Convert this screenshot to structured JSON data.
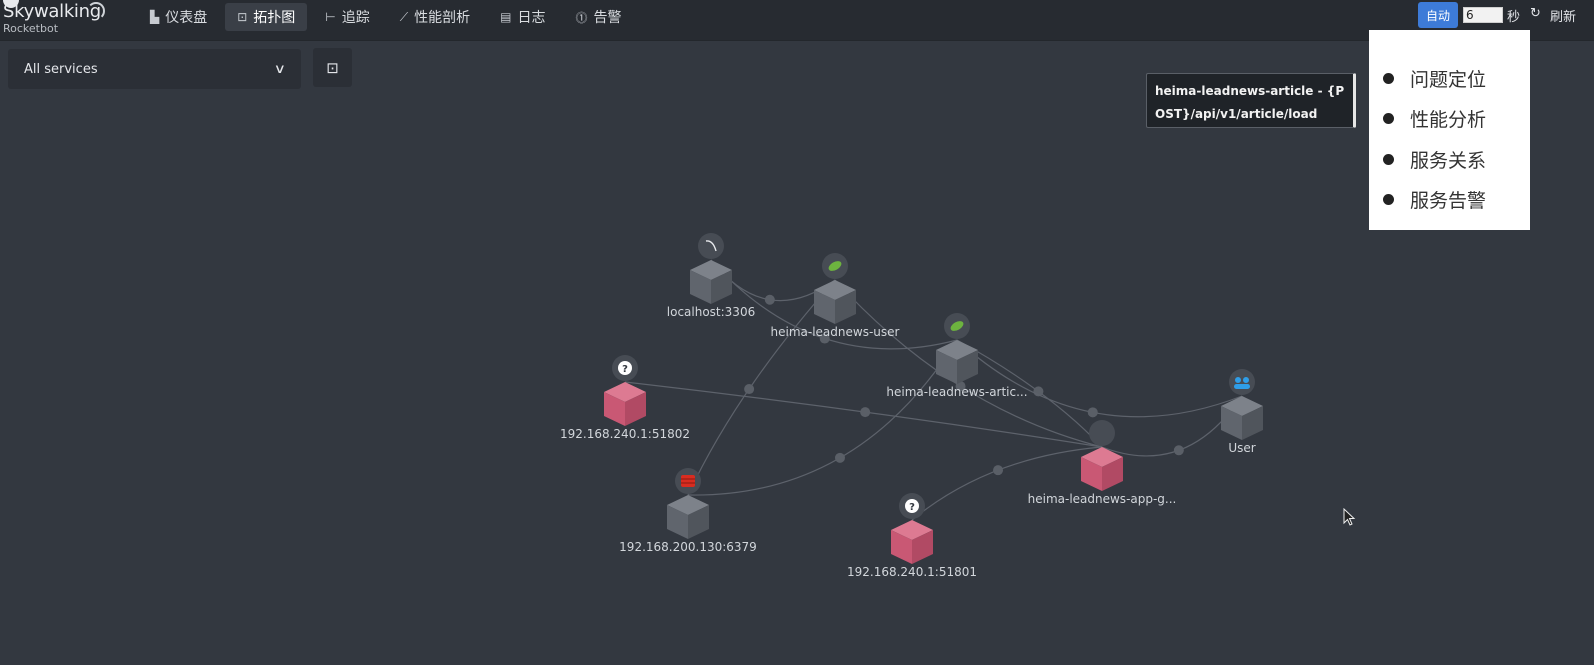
{
  "brand": {
    "name": "Skywalking",
    "sub": "Rocketbot"
  },
  "nav": [
    {
      "label": "仪表盘",
      "icon": "bar-chart-icon",
      "glyph": "▙"
    },
    {
      "label": "拓扑图",
      "icon": "topology-icon",
      "glyph": "⊡",
      "active": true
    },
    {
      "label": "追踪",
      "icon": "trace-icon",
      "glyph": "⊢"
    },
    {
      "label": "性能剖析",
      "icon": "profile-icon",
      "glyph": "⟋"
    },
    {
      "label": "日志",
      "icon": "log-icon",
      "glyph": "▤"
    },
    {
      "label": "告警",
      "icon": "alarm-icon",
      "glyph": "⓵"
    }
  ],
  "toolbar": {
    "auto_label": "自动",
    "interval_value": "6",
    "sec_label": "秒",
    "refresh_label": "刷新"
  },
  "filter": {
    "selected": "All services"
  },
  "tooltip": {
    "text": "heima-leadnews-article - {POST}/api/v1/article/load"
  },
  "context_menu": {
    "items": [
      "问题定位",
      "性能分析",
      "服务关系",
      "服务告警"
    ]
  },
  "colors": {
    "accent": "#3d7bd8",
    "node_normal": "#5f646d",
    "node_error": "#c95874",
    "background": "#333840",
    "topbar": "#272b31"
  },
  "topology": {
    "nodes": [
      {
        "id": "mysql",
        "label": "localhost:3306",
        "icon": "mysql-icon",
        "status": "normal"
      },
      {
        "id": "user",
        "label": "heima-leadnews-user",
        "icon": "spring-icon",
        "status": "normal"
      },
      {
        "id": "article",
        "label": "heima-leadnews-artic...",
        "icon": "spring-icon",
        "status": "normal"
      },
      {
        "id": "ip51802",
        "label": "192.168.240.1:51802",
        "icon": "unknown-icon",
        "status": "error"
      },
      {
        "id": "redis",
        "label": "192.168.200.130:6379",
        "icon": "redis-icon",
        "status": "normal"
      },
      {
        "id": "ip51801",
        "label": "192.168.240.1:51801",
        "icon": "unknown-icon",
        "status": "error"
      },
      {
        "id": "gateway",
        "label": "heima-leadnews-app-g...",
        "icon": "gateway-icon",
        "status": "error"
      },
      {
        "id": "usr",
        "label": "User",
        "icon": "users-icon",
        "status": "normal"
      }
    ],
    "edges": [
      [
        "user",
        "mysql"
      ],
      [
        "article",
        "mysql"
      ],
      [
        "article",
        "redis"
      ],
      [
        "user",
        "redis"
      ],
      [
        "gateway",
        "user"
      ],
      [
        "gateway",
        "article"
      ],
      [
        "usr",
        "gateway"
      ],
      [
        "usr",
        "article"
      ],
      [
        "ip51802",
        "gateway"
      ],
      [
        "ip51801",
        "gateway"
      ]
    ]
  }
}
